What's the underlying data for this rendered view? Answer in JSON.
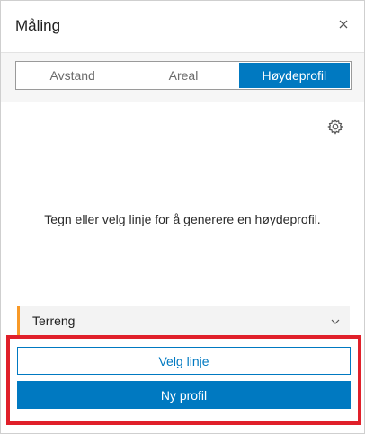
{
  "header": {
    "title": "Måling",
    "close_label": "×"
  },
  "tabs": [
    {
      "label": "Avstand",
      "active": false
    },
    {
      "label": "Areal",
      "active": false
    },
    {
      "label": "Høydeprofil",
      "active": true
    }
  ],
  "main": {
    "settings_icon": "gear-icon",
    "message": "Tegn eller velg linje for å generere en høydeprofil."
  },
  "elevation_source": {
    "selected": "Terreng",
    "icon": "chevron-down-icon"
  },
  "actions": {
    "select_line_label": "Velg linje",
    "new_profile_label": "Ny profil"
  },
  "colors": {
    "accent": "#0079c1",
    "highlight_border": "#e0202a",
    "dropdown_marker": "#f89927"
  }
}
